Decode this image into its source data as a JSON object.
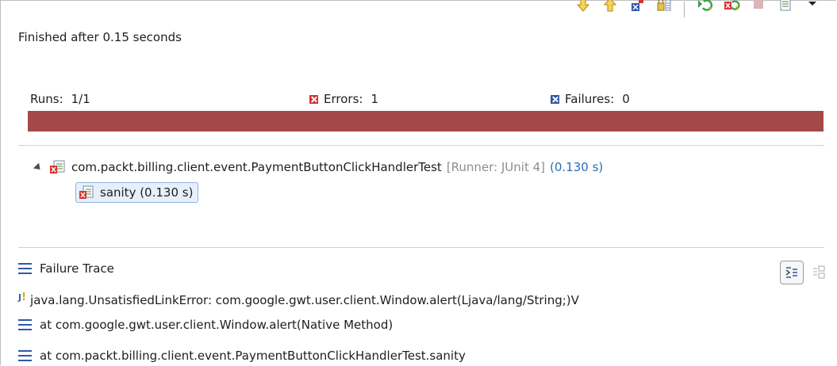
{
  "toolbar": {
    "buttons": [
      {
        "icon": "next-failure-icon"
      },
      {
        "icon": "previous-failure-icon"
      },
      {
        "icon": "show-failures-only-icon"
      },
      {
        "icon": "scroll-lock-icon"
      },
      {
        "icon": "rerun-test-icon"
      },
      {
        "icon": "rerun-failed-first-icon"
      },
      {
        "icon": "stop-icon"
      },
      {
        "icon": "test-run-history-icon"
      },
      {
        "icon": "view-menu-icon"
      }
    ]
  },
  "status": "Finished after 0.15 seconds",
  "counters": {
    "runs_label": "Runs:",
    "runs_value": "1/1",
    "errors_label": "Errors:",
    "errors_value": "1",
    "failures_label": "Failures:",
    "failures_value": "0"
  },
  "progress": {
    "fraction": 1.0,
    "color": "#a5484a"
  },
  "tree": {
    "suite_name": "com.packt.billing.client.event.PaymentButtonClickHandlerTest",
    "suite_runner": "[Runner: JUnit 4]",
    "suite_time": "(0.130 s)",
    "test_label": "sanity (0.130 s)"
  },
  "failure_trace": {
    "title": "Failure Trace",
    "lines": [
      "java.lang.UnsatisfiedLinkError: com.google.gwt.user.client.Window.alert(Ljava/lang/String;)V",
      "at com.google.gwt.user.client.Window.alert(Native Method)",
      "at com.packt.billing.client.event.PaymentButtonClickHandlerTest.sanity"
    ]
  },
  "colors": {
    "error": "#d6332f",
    "failure": "#2f57a8",
    "time": "#2a6cb8"
  }
}
